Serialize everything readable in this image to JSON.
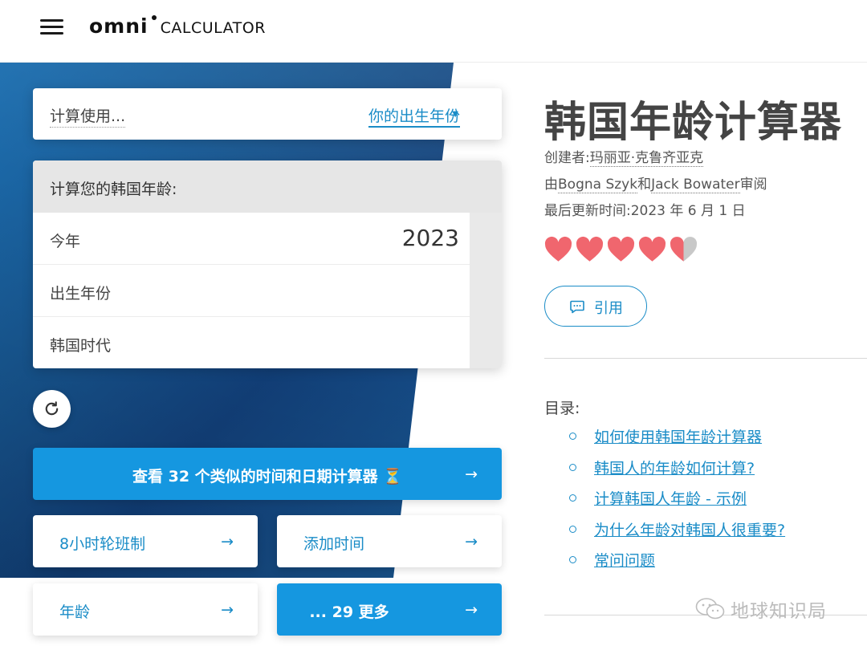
{
  "header": {
    "logo_main": "omni",
    "logo_sub": "CALCULATOR"
  },
  "calc_using": {
    "label": "计算使用...",
    "selected": "你的出生年份"
  },
  "form": {
    "heading": "计算您的韩国年龄:",
    "fields": [
      {
        "label": "今年",
        "value": "2023"
      },
      {
        "label": "出生年份",
        "value": ""
      },
      {
        "label": "韩国时代",
        "value": ""
      }
    ]
  },
  "buttons": {
    "similar": "查看 32 个类似的时间和日期计算器 ⏳",
    "shift": "8小时轮班制",
    "add_time": "添加时间",
    "age": "年龄",
    "more": "... 29 更多",
    "arrow": "→"
  },
  "article": {
    "title": "韩国年龄计算器",
    "creator_prefix": "创建者:",
    "creator_name": "玛丽亚·克鲁齐亚克",
    "review_prefix": "由",
    "reviewer1": "Bogna Szyk",
    "review_and": "和",
    "reviewer2": "Jack Bowater",
    "review_suffix": "审阅",
    "updated": "最后更新时间:2023 年 6 月 1 日",
    "rating": 4.5,
    "heart_color": "#f0666e",
    "cite_label": "引用"
  },
  "toc": {
    "title": "目录:",
    "items": [
      "如何使用韩国年龄计算器",
      "韩国人的年龄如何计算?",
      "计算韩国人年龄 - 示例",
      "为什么年龄对韩国人很重要?",
      "常问问题"
    ]
  },
  "watermark": {
    "text": "地球知识局"
  },
  "colors": {
    "accent": "#1a8cc7",
    "button_blue": "#1597e0",
    "panel_blue": "#17558f"
  }
}
